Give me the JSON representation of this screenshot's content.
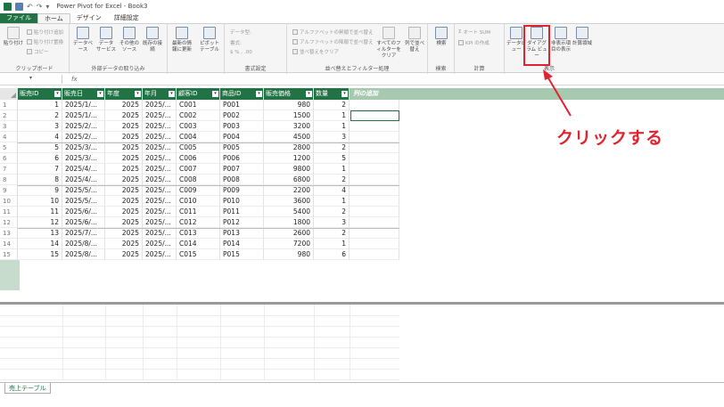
{
  "app": {
    "title": "Power Pivot for Excel - Book3"
  },
  "tabs": [
    "ファイル",
    "ホーム",
    "デザイン",
    "詳細設定"
  ],
  "ribbon": {
    "clipboard": {
      "label": "クリップボード",
      "paste": "貼り付け",
      "append": "貼り付け追加",
      "replace": "貼り付け置換",
      "copy": "コピー"
    },
    "external": {
      "label": "外部データの取り込み",
      "db": "データベース",
      "dataservice": "データ サービス",
      "other": "その他のソース",
      "existing": "既存の接続"
    },
    "refresh": {
      "label": "最新の情報に更新"
    },
    "pivot": {
      "label": "ピボットテーブル"
    },
    "format": {
      "label": "書式設定",
      "datatype": "データ型:",
      "formatlbl": "書式:",
      "currency": "$ % ,",
      "dec": ".00"
    },
    "sort": {
      "label": "並べ替えとフィルター処理",
      "asc": "アルファベットの昇順で並べ替え",
      "desc": "アルファベットの降順で並べ替え",
      "clear": "並べ替えをクリア",
      "clearfilter": "すべてのフィルターをクリア",
      "bycol": "列で並べ替え"
    },
    "find": {
      "label": "検索",
      "find": "検索"
    },
    "calc": {
      "label": "計算",
      "autosum": "オート SUM",
      "kpi": "KPI の作成"
    },
    "view": {
      "label": "表示",
      "dataview": "データビュー",
      "diagramview": "ダイアグラム ビュー",
      "hidden": "非表示項目の表示",
      "calcarea": "計算領域"
    }
  },
  "formula_bar": {
    "namebox": "▾",
    "fx": "fx"
  },
  "table": {
    "columns": [
      "販売ID",
      "販売日",
      "年度",
      "年月",
      "顧客ID",
      "商品ID",
      "販売価格",
      "数量"
    ],
    "add_column": "列の追加",
    "rows": [
      [
        "1",
        "2025/1/...",
        "2025",
        "2025/...",
        "C001",
        "P001",
        "980",
        "2"
      ],
      [
        "2",
        "2025/1/...",
        "2025",
        "2025/...",
        "C002",
        "P002",
        "1500",
        "1"
      ],
      [
        "3",
        "2025/2/...",
        "2025",
        "2025/...",
        "C003",
        "P003",
        "3200",
        "1"
      ],
      [
        "4",
        "2025/2/...",
        "2025",
        "2025/...",
        "C004",
        "P004",
        "4500",
        "3"
      ],
      [
        "5",
        "2025/3/...",
        "2025",
        "2025/...",
        "C005",
        "P005",
        "2800",
        "2"
      ],
      [
        "6",
        "2025/3/...",
        "2025",
        "2025/...",
        "C006",
        "P006",
        "1200",
        "5"
      ],
      [
        "7",
        "2025/4/...",
        "2025",
        "2025/...",
        "C007",
        "P007",
        "9800",
        "1"
      ],
      [
        "8",
        "2025/4/...",
        "2025",
        "2025/...",
        "C008",
        "P008",
        "6800",
        "2"
      ],
      [
        "9",
        "2025/5/...",
        "2025",
        "2025/...",
        "C009",
        "P009",
        "2200",
        "4"
      ],
      [
        "10",
        "2025/5/...",
        "2025",
        "2025/...",
        "C010",
        "P010",
        "3600",
        "1"
      ],
      [
        "11",
        "2025/6/...",
        "2025",
        "2025/...",
        "C011",
        "P011",
        "5400",
        "2"
      ],
      [
        "12",
        "2025/6/...",
        "2025",
        "2025/...",
        "C012",
        "P012",
        "1800",
        "3"
      ],
      [
        "13",
        "2025/7/...",
        "2025",
        "2025/...",
        "C013",
        "P013",
        "2600",
        "2"
      ],
      [
        "14",
        "2025/8/...",
        "2025",
        "2025/...",
        "C014",
        "P014",
        "7200",
        "1"
      ],
      [
        "15",
        "2025/8/...",
        "2025",
        "2025/...",
        "C015",
        "P015",
        "980",
        "6"
      ]
    ]
  },
  "sheet_tab": "売上テーブル",
  "annotation": {
    "text": "クリックする",
    "color": "#e0232e"
  },
  "colors": {
    "accent": "#217346",
    "header_band": "#a7c9b0",
    "highlight": "#e0232e"
  }
}
